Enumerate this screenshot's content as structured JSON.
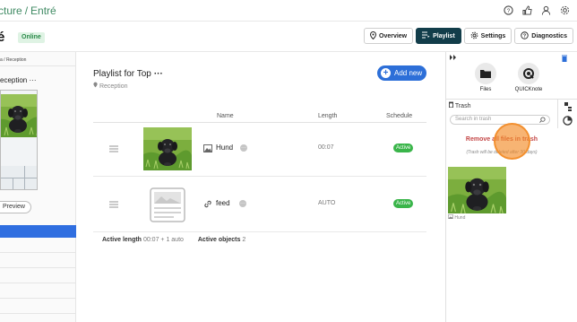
{
  "header": {
    "breadcrumb_parent": "cture",
    "breadcrumb_separator": "/",
    "breadcrumb_current": "Entré",
    "icons": [
      "help-icon",
      "thumbs-up-icon",
      "user-icon",
      "settings-icon"
    ]
  },
  "screen": {
    "name_fragment": "é",
    "status": "Online"
  },
  "tabs": [
    {
      "label": "Overview",
      "icon": "location-pin-icon",
      "active": false
    },
    {
      "label": "Playlist",
      "icon": "playlist-icon",
      "active": true
    },
    {
      "label": "Settings",
      "icon": "gear-icon",
      "active": false
    },
    {
      "label": "Diagnostics",
      "icon": "question-icon",
      "active": false
    }
  ],
  "left_panel": {
    "path": "a / Reception",
    "screen_name": "eception",
    "screen_menu": "···",
    "preview_label": "Preview"
  },
  "playlist": {
    "title": "Playlist for Top",
    "menu": "···",
    "location": "Reception",
    "add_button": "Add new",
    "columns": {
      "name": "Name",
      "length": "Length",
      "schedule": "Schedule"
    },
    "items": [
      {
        "name": "Hund",
        "type_icon": "image-icon",
        "length": "00:07",
        "status": "Active"
      },
      {
        "name": "feed",
        "type_icon": "link-icon",
        "length": "AUTO",
        "status": "Active"
      }
    ],
    "footer": {
      "active_length_label": "Active length",
      "active_length_value": "00:07 + 1 auto",
      "active_objects_label": "Active objects",
      "active_objects_value": "2"
    }
  },
  "library": {
    "sources": [
      {
        "label": "Files",
        "icon": "folder-icon"
      },
      {
        "label": "QUICKnote",
        "icon": "quicknote-icon"
      }
    ],
    "trash_header": "Trash",
    "search_placeholder": "Search in trash",
    "remove_all": "Remove all files in trash",
    "note": "(Trash will be deleted after 30 days)",
    "trash_items": [
      {
        "name": "Hund"
      }
    ]
  },
  "colors": {
    "accent_blue": "#2d6fd8",
    "active_tab": "#123d4a",
    "active_badge": "#3ab54a",
    "breadcrumb_green": "#3f8a63",
    "danger_red": "#c44747",
    "cursor_orange": "#f28c28"
  }
}
